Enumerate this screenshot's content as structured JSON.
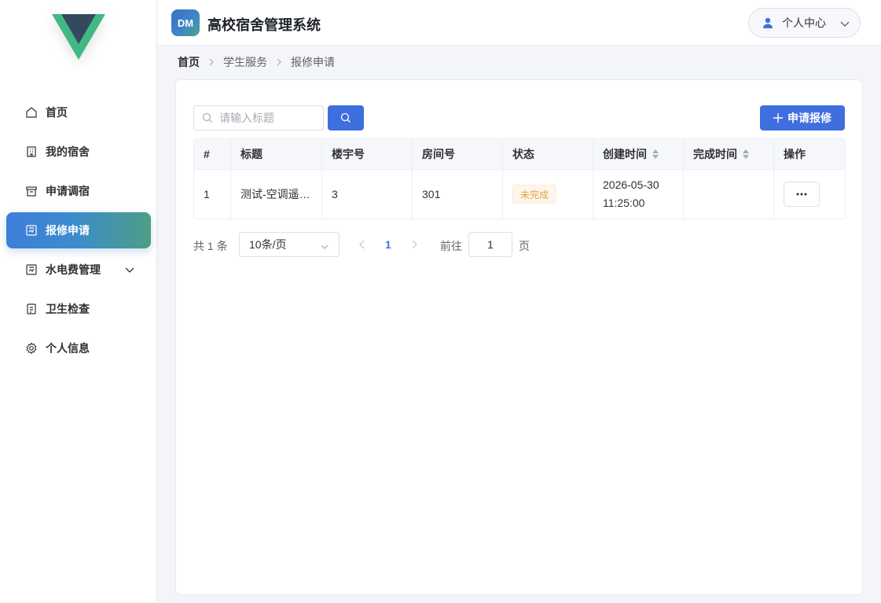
{
  "app": {
    "badge": "DM",
    "title": "高校宿舍管理系统"
  },
  "user_menu": {
    "label": "个人中心"
  },
  "sidebar": {
    "items": [
      {
        "label": "首页",
        "icon": "home-icon"
      },
      {
        "label": "我的宿舍",
        "icon": "building-icon"
      },
      {
        "label": "申请调宿",
        "icon": "box-icon"
      },
      {
        "label": "报修申请",
        "icon": "tools-icon",
        "active": true
      },
      {
        "label": "水电费管理",
        "icon": "meter-icon",
        "expandable": true
      },
      {
        "label": "卫生检查",
        "icon": "document-icon"
      },
      {
        "label": "个人信息",
        "icon": "gear-icon"
      }
    ]
  },
  "breadcrumb": [
    "首页",
    "学生服务",
    "报修申请"
  ],
  "search": {
    "placeholder": "请输入标题",
    "value": ""
  },
  "toolbar": {
    "apply_label": "申请报修"
  },
  "table": {
    "columns": [
      "#",
      "标题",
      "楼宇号",
      "房间号",
      "状态",
      "创建时间",
      "完成时间",
      "操作"
    ],
    "rows": [
      {
        "index": "1",
        "title": "测试-空调遥控器坏了",
        "building": "3",
        "room": "301",
        "status": "未完成",
        "created_date": "2026-05-30",
        "created_time": "11:25:00",
        "finished": ""
      }
    ]
  },
  "pagination": {
    "total": "共 1 条",
    "page_size": "10条/页",
    "current_page": "1",
    "goto_label": "前往",
    "goto_value": "1",
    "page_suffix": "页"
  },
  "colors": {
    "primary": "#3f6fdf",
    "warning": "#e6a23c",
    "logo_dark": "#34495e",
    "logo_green": "#41b883"
  }
}
